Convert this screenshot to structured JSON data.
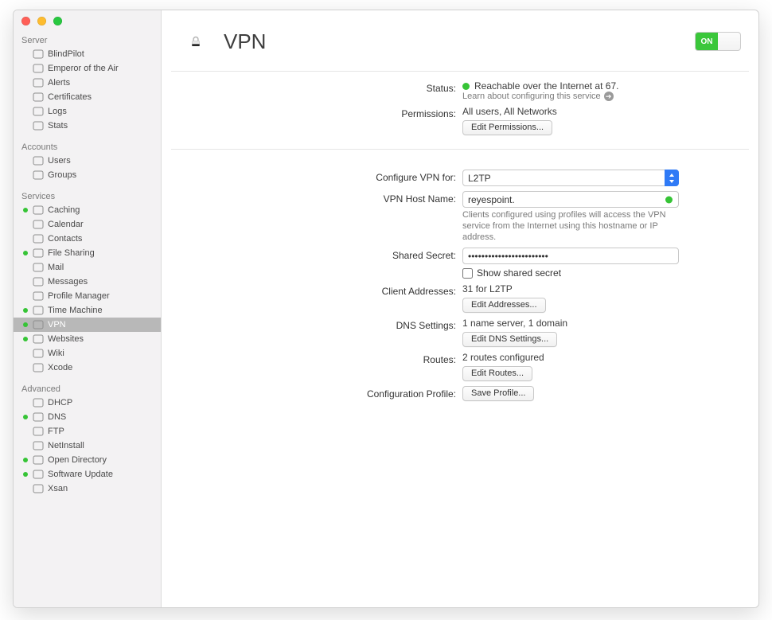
{
  "sidebar": {
    "sections": {
      "server": {
        "title": "Server",
        "items": [
          {
            "label": "BlindPilot"
          },
          {
            "label": "Emperor of the Air"
          },
          {
            "label": "Alerts"
          },
          {
            "label": "Certificates"
          },
          {
            "label": "Logs"
          },
          {
            "label": "Stats"
          }
        ]
      },
      "accounts": {
        "title": "Accounts",
        "items": [
          {
            "label": "Users"
          },
          {
            "label": "Groups"
          }
        ]
      },
      "services": {
        "title": "Services",
        "items": [
          {
            "label": "Caching",
            "on": true
          },
          {
            "label": "Calendar"
          },
          {
            "label": "Contacts"
          },
          {
            "label": "File Sharing",
            "on": true
          },
          {
            "label": "Mail"
          },
          {
            "label": "Messages"
          },
          {
            "label": "Profile Manager"
          },
          {
            "label": "Time Machine",
            "on": true
          },
          {
            "label": "VPN",
            "on": true,
            "selected": true
          },
          {
            "label": "Websites",
            "on": true
          },
          {
            "label": "Wiki"
          },
          {
            "label": "Xcode"
          }
        ]
      },
      "advanced": {
        "title": "Advanced",
        "items": [
          {
            "label": "DHCP"
          },
          {
            "label": "DNS",
            "on": true
          },
          {
            "label": "FTP"
          },
          {
            "label": "NetInstall"
          },
          {
            "label": "Open Directory",
            "on": true
          },
          {
            "label": "Software Update",
            "on": true
          },
          {
            "label": "Xsan"
          }
        ]
      }
    }
  },
  "header": {
    "title": "VPN",
    "toggle_on": "ON"
  },
  "status": {
    "label": "Status:",
    "text": "Reachable over the Internet at 67.",
    "learn": "Learn about configuring this service"
  },
  "permissions": {
    "label": "Permissions:",
    "value": "All users, All Networks",
    "button": "Edit Permissions..."
  },
  "configure": {
    "label": "Configure VPN for:",
    "value": "L2TP"
  },
  "host": {
    "label": "VPN Host Name:",
    "value": "reyespoint.",
    "help": "Clients configured using profiles will access the VPN service from the Internet using this hostname or IP address."
  },
  "secret": {
    "label": "Shared Secret:",
    "value": "••••••••••••••••••••••••",
    "show": "Show shared secret"
  },
  "clients": {
    "label": "Client Addresses:",
    "value": "31 for L2TP",
    "button": "Edit Addresses..."
  },
  "dns": {
    "label": "DNS Settings:",
    "value": "1 name server, 1 domain",
    "button": "Edit DNS Settings..."
  },
  "routes": {
    "label": "Routes:",
    "value": "2 routes configured",
    "button": "Edit Routes..."
  },
  "profile": {
    "label": "Configuration Profile:",
    "button": "Save Profile..."
  }
}
